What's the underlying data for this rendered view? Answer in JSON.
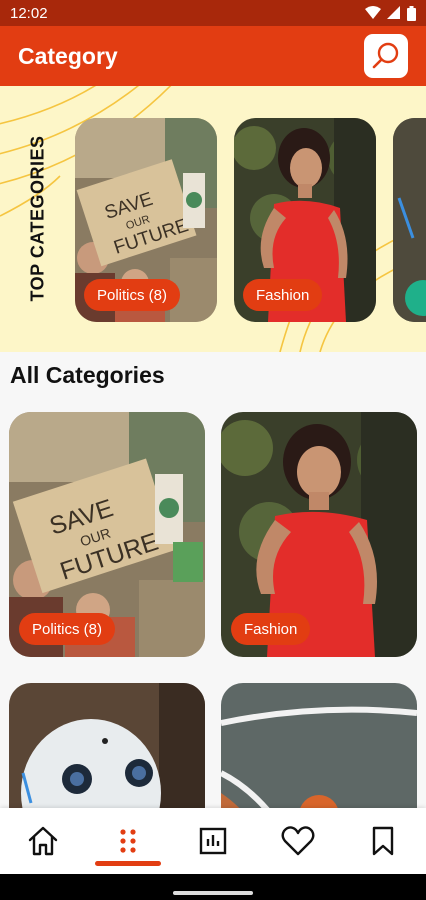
{
  "status_bar": {
    "time": "12:02",
    "icons": [
      "wifi-icon",
      "signal-icon",
      "battery-icon"
    ]
  },
  "app_bar": {
    "title": "Category",
    "search_icon": "search-icon"
  },
  "top_categories": {
    "label": "TOP CATEGORIES",
    "items": [
      {
        "label": "Politics (8)",
        "image": "protest-sign-photo",
        "sign_text": [
          "SAVE",
          "OUR",
          "FUTURE"
        ]
      },
      {
        "label": "Fashion",
        "image": "woman-red-dress-photo"
      },
      {
        "label": "",
        "image": "partial-card"
      }
    ]
  },
  "all_categories": {
    "title": "All Categories",
    "items": [
      {
        "label": "Politics (8)",
        "image": "protest-sign-photo",
        "sign_text": [
          "SAVE",
          "OUR",
          "FUTURE"
        ]
      },
      {
        "label": "Fashion",
        "image": "woman-red-dress-photo"
      },
      {
        "label": "",
        "image": "robot-photo"
      },
      {
        "label": "",
        "image": "basketball-court-photo"
      }
    ]
  },
  "bottom_nav": {
    "items": [
      {
        "icon": "home-icon",
        "active": false
      },
      {
        "icon": "category-dots-icon",
        "active": true
      },
      {
        "icon": "chart-icon",
        "active": false
      },
      {
        "icon": "heart-icon",
        "active": false
      },
      {
        "icon": "bookmark-icon",
        "active": false
      }
    ]
  },
  "colors": {
    "accent": "#e23d12",
    "status_bar": "#a8280b",
    "band": "#fdf6c8"
  }
}
